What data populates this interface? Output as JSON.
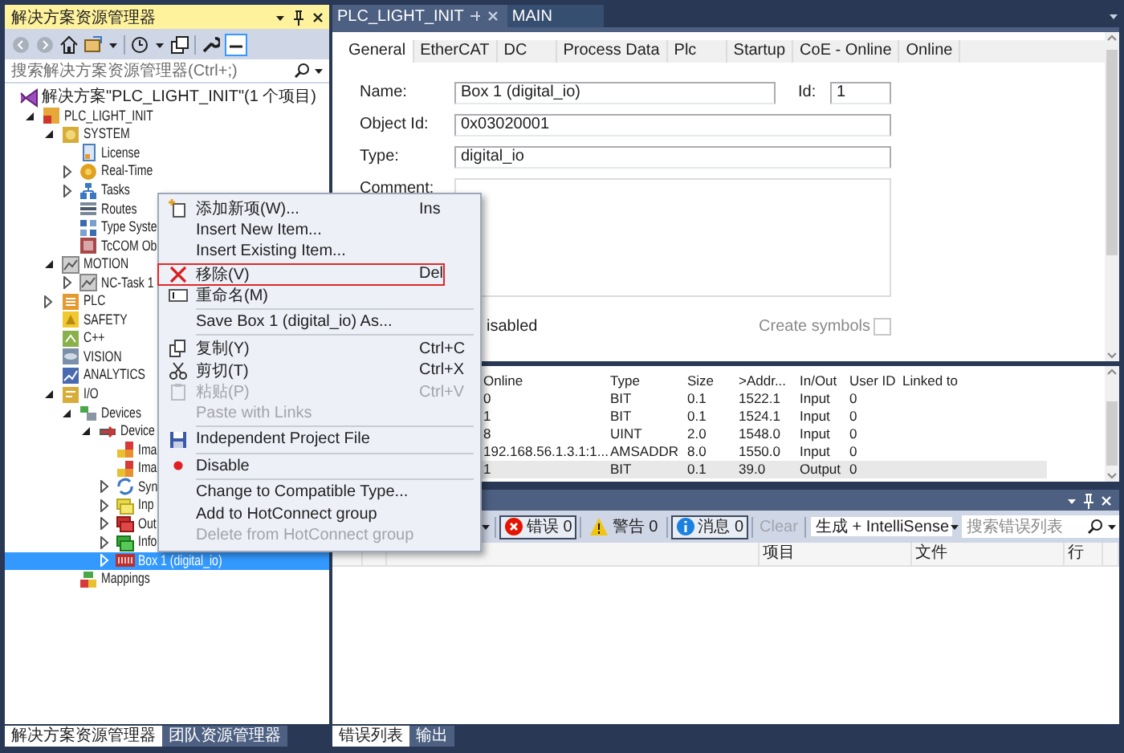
{
  "explorer": {
    "title": "解决方案资源管理器",
    "search": {
      "placeholder": "搜索解决方案资源管理器(Ctrl+;)"
    },
    "solution": {
      "label": "解决方案\"PLC_LIGHT_INIT\"(1 个项目)"
    },
    "tree": [
      {
        "label": "PLC_LIGHT_INIT",
        "kind": "project",
        "expanded": true,
        "selected": false,
        "children": [
          {
            "label": "SYSTEM",
            "kind": "system",
            "expanded": true,
            "selected": false,
            "children": [
              {
                "label": "License",
                "kind": "license",
                "selected": false
              },
              {
                "label": "Real-Time",
                "kind": "realtime",
                "expanded": false,
                "selected": false
              },
              {
                "label": "Tasks",
                "kind": "tasks",
                "expanded": false,
                "selected": false
              },
              {
                "label": "Routes",
                "kind": "routes",
                "selected": false
              },
              {
                "label": "Type Syste",
                "kind": "types",
                "selected": false
              },
              {
                "label": "TcCOM Ob",
                "kind": "tccom",
                "selected": false
              }
            ]
          },
          {
            "label": "MOTION",
            "kind": "motion",
            "expanded": true,
            "selected": false,
            "children": [
              {
                "label": "NC-Task 1",
                "kind": "motion",
                "expanded": false,
                "selected": false
              }
            ]
          },
          {
            "label": "PLC",
            "kind": "plc",
            "expanded": false,
            "selected": false
          },
          {
            "label": "SAFETY",
            "kind": "safety",
            "selected": false
          },
          {
            "label": "C++",
            "kind": "cpp",
            "selected": false
          },
          {
            "label": "VISION",
            "kind": "vision",
            "selected": false
          },
          {
            "label": "ANALYTICS",
            "kind": "analytics",
            "selected": false
          },
          {
            "label": "I/O",
            "kind": "io",
            "expanded": true,
            "selected": false,
            "children": [
              {
                "label": "Devices",
                "kind": "devices",
                "expanded": true,
                "selected": false,
                "children": [
                  {
                    "label": "Device",
                    "kind": "device",
                    "expanded": true,
                    "selected": false,
                    "children": [
                      {
                        "label": "Ima",
                        "kind": "image",
                        "selected": false
                      },
                      {
                        "label": "Ima",
                        "kind": "image",
                        "selected": false
                      },
                      {
                        "label": "Syn",
                        "kind": "sync",
                        "expanded": false,
                        "selected": false
                      },
                      {
                        "label": "Inp",
                        "kind": "inputs",
                        "expanded": false,
                        "selected": false
                      },
                      {
                        "label": "Out",
                        "kind": "outputs",
                        "expanded": false,
                        "selected": false
                      },
                      {
                        "label": "Info",
                        "kind": "info",
                        "expanded": false,
                        "selected": false
                      },
                      {
                        "label": "Box 1 (digital_io)",
                        "kind": "box",
                        "expanded": false,
                        "selected": true
                      }
                    ]
                  }
                ]
              },
              {
                "label": "Mappings",
                "kind": "mappings",
                "selected": false
              }
            ]
          }
        ]
      }
    ],
    "tabs": [
      {
        "label": "解决方案资源管理器",
        "selected": true
      },
      {
        "label": "团队资源管理器",
        "selected": false
      }
    ]
  },
  "context_menu": {
    "items": [
      {
        "kind": "add",
        "label": "添加新项(W)...",
        "shortcut": "Ins",
        "disabled": false,
        "highlighted": false
      },
      {
        "kind": "plain",
        "label": "Insert New Item...",
        "disabled": false,
        "highlighted": false
      },
      {
        "kind": "plain",
        "label": "Insert Existing Item...",
        "disabled": false,
        "highlighted": false
      },
      {
        "kind": "remove",
        "label": "移除(V)",
        "shortcut": "Del",
        "disabled": false,
        "highlighted": true
      },
      {
        "kind": "rename",
        "label": "重命名(M)",
        "disabled": false,
        "highlighted": false
      },
      {
        "kind": "separator"
      },
      {
        "kind": "plain",
        "label": "Save Box 1 (digital_io) As...",
        "disabled": false,
        "highlighted": false
      },
      {
        "kind": "separator"
      },
      {
        "kind": "copy",
        "label": "复制(Y)",
        "shortcut": "Ctrl+C",
        "disabled": false,
        "highlighted": false
      },
      {
        "kind": "cut",
        "label": "剪切(T)",
        "shortcut": "Ctrl+X",
        "disabled": false,
        "highlighted": false
      },
      {
        "kind": "paste",
        "label": "粘贴(P)",
        "shortcut": "Ctrl+V",
        "disabled": true,
        "highlighted": false
      },
      {
        "kind": "plain",
        "label": "Paste with Links",
        "disabled": true,
        "highlighted": false
      },
      {
        "kind": "separator"
      },
      {
        "kind": "save",
        "label": "Independent Project File",
        "disabled": false,
        "highlighted": false
      },
      {
        "kind": "separator"
      },
      {
        "kind": "disable",
        "label": "Disable",
        "disabled": false,
        "highlighted": false
      },
      {
        "kind": "separator"
      },
      {
        "kind": "plain",
        "label": "Change to Compatible Type...",
        "disabled": false,
        "highlighted": false
      },
      {
        "kind": "plain",
        "label": "Add to HotConnect group",
        "disabled": false,
        "highlighted": false
      },
      {
        "kind": "plain",
        "label": "Delete from HotConnect group",
        "disabled": true,
        "highlighted": false
      }
    ]
  },
  "editor": {
    "document_tabs": [
      {
        "label": "PLC_LIGHT_INIT",
        "selected": true
      },
      {
        "label": "MAIN",
        "selected": false
      }
    ],
    "tabs": [
      {
        "label": "General",
        "selected": true
      },
      {
        "label": "EtherCAT",
        "selected": false
      },
      {
        "label": "DC",
        "selected": false
      },
      {
        "label": "Process Data",
        "selected": false
      },
      {
        "label": "Plc",
        "selected": false
      },
      {
        "label": "Startup",
        "selected": false
      },
      {
        "label": "CoE - Online",
        "selected": false
      },
      {
        "label": "Online",
        "selected": false
      }
    ],
    "form": {
      "name_label": "Name:",
      "name": "Box 1 (digital_io)",
      "id_label": "Id:",
      "id": "1",
      "object_id_label": "Object Id:",
      "object_id": "0x03020001",
      "type_label": "Type:",
      "type": "digital_io",
      "comment_label": "Comment:",
      "disabled_label": "isabled",
      "create_symbols": {
        "label": "Create symbols",
        "checked": false,
        "disabled": true
      }
    },
    "table": {
      "columns": [
        "Online",
        "Type",
        "Size",
        ">Addr...",
        "In/Out",
        "User ID",
        "Linked to"
      ],
      "rows": [
        {
          "cells": [
            "0",
            "BIT",
            "0.1",
            "1522.1",
            "Input",
            "0"
          ],
          "selected": false
        },
        {
          "cells": [
            "1",
            "BIT",
            "0.1",
            "1524.1",
            "Input",
            "0"
          ],
          "selected": false
        },
        {
          "cells": [
            "8",
            "UINT",
            "2.0",
            "1548.0",
            "Input",
            "0"
          ],
          "selected": false
        },
        {
          "cells": [
            "192.168.56.1.3.1:1...",
            "AMSADDR",
            "8.0",
            "1550.0",
            "Input",
            "0"
          ],
          "selected": false
        },
        {
          "cells": [
            "1",
            "BIT",
            "0.1",
            "39.0",
            "Output",
            "0"
          ],
          "selected": true
        }
      ]
    }
  },
  "error_list": {
    "filters": [
      {
        "kind": "error",
        "label": "错误 0",
        "on": true
      },
      {
        "kind": "warning",
        "label": "警告 0",
        "on": false
      },
      {
        "kind": "message",
        "label": "消息 0",
        "on": true
      }
    ],
    "clear": {
      "label": "Clear",
      "disabled": true
    },
    "scope": "生成 + IntelliSense",
    "search": {
      "placeholder": "搜索错误列表"
    },
    "columns": [
      "项目",
      "文件",
      "行"
    ],
    "tabs": [
      {
        "label": "错误列表",
        "selected": true
      },
      {
        "label": "输出",
        "selected": false
      }
    ]
  }
}
